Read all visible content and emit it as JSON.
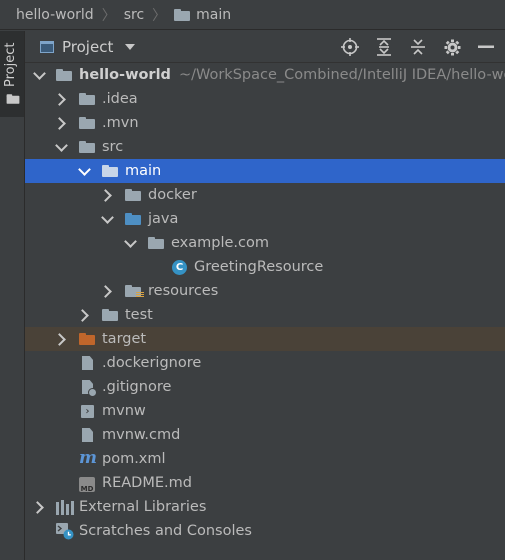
{
  "breadcrumb": {
    "items": [
      "hello-world",
      "src",
      "main"
    ]
  },
  "left_tool_tab": {
    "label": "Project"
  },
  "tool_window": {
    "view_label": "Project",
    "icons": [
      "locate-icon",
      "expand-all-icon",
      "collapse-all-icon",
      "gear-icon",
      "hide-icon"
    ]
  },
  "tree": {
    "root": {
      "label": "hello-world",
      "path": "~/WorkSpace_Combined/IntelliJ IDEA/hello-wor"
    },
    "idea": ".idea",
    "mvn": ".mvn",
    "src": "src",
    "main": "main",
    "docker": "docker",
    "java": "java",
    "package": "example.com",
    "class": "GreetingResource",
    "class_letter": "C",
    "resources": "resources",
    "test": "test",
    "target": "target",
    "dockerignore": ".dockerignore",
    "gitignore": ".gitignore",
    "mvnw": "mvnw",
    "mvnw_cmd": "mvnw.cmd",
    "pom": "pom.xml",
    "readme": "README.md",
    "readme_badge": "MD",
    "external_libraries": "External Libraries",
    "scratches": "Scratches and Consoles"
  },
  "colors": {
    "background": "#3c3f41",
    "selection": "#2f65ca",
    "excluded_row": "#4a4238",
    "folder": "#9aa7b0",
    "source_folder": "#4e8fc3",
    "excluded_folder": "#c0662b",
    "module_root_folder": "#5aa9e6"
  }
}
